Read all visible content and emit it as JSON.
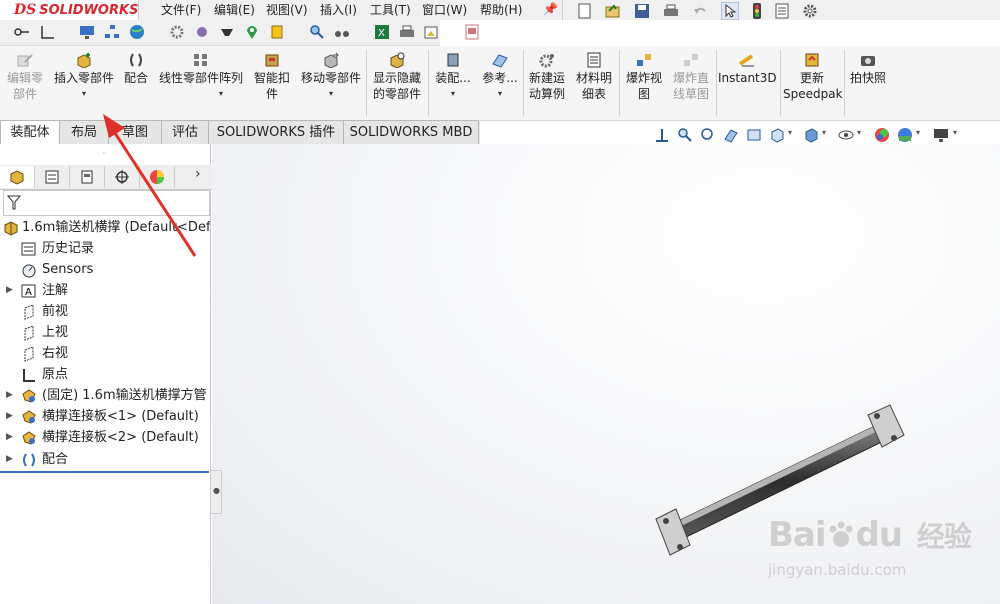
{
  "app": {
    "logo_ds": "DS",
    "logo_text": "SOLIDWORKS"
  },
  "menu": [
    "文件(F)",
    "编辑(E)",
    "视图(V)",
    "插入(I)",
    "工具(T)",
    "窗口(W)",
    "帮助(H)"
  ],
  "commands": [
    {
      "label": "编辑零\n部件",
      "disabled": true,
      "icon": "edit-component-icon"
    },
    {
      "label": "插入零部件",
      "disabled": false,
      "icon": "insert-component-icon"
    },
    {
      "label": "配合",
      "disabled": false,
      "icon": "mate-icon"
    },
    {
      "label": "线性零部件阵列",
      "disabled": false,
      "icon": "linear-pattern-icon"
    },
    {
      "label": "智能扣\n件",
      "disabled": false,
      "icon": "smart-fastener-icon"
    },
    {
      "label": "移动零部件",
      "disabled": false,
      "icon": "move-component-icon"
    },
    {
      "label": "显示隐藏\n的零部件",
      "disabled": false,
      "icon": "show-hidden-icon"
    },
    {
      "label": "装配...",
      "disabled": false,
      "icon": "assembly-features-icon"
    },
    {
      "label": "参考...",
      "disabled": false,
      "icon": "reference-geometry-icon"
    },
    {
      "label": "新建运\n动算例",
      "disabled": false,
      "icon": "motion-study-icon"
    },
    {
      "label": "材料明\n细表",
      "disabled": false,
      "icon": "bom-icon"
    },
    {
      "label": "爆炸视\n图",
      "disabled": false,
      "icon": "exploded-view-icon"
    },
    {
      "label": "爆炸直\n线草图",
      "disabled": true,
      "icon": "explode-line-sketch-icon"
    },
    {
      "label": "Instant3D",
      "disabled": false,
      "icon": "instant3d-icon"
    },
    {
      "label": "更新\nSpeedpak",
      "disabled": false,
      "icon": "speedpak-icon"
    },
    {
      "label": "拍快照",
      "disabled": false,
      "icon": "snapshot-icon"
    }
  ],
  "tabs": [
    "装配体",
    "布局",
    "草图",
    "评估",
    "SOLIDWORKS 插件",
    "SOLIDWORKS MBD"
  ],
  "tree": {
    "root": "1.6m输送机横撑  (Default<Def",
    "items": [
      {
        "label": "历史记录",
        "expand": false,
        "icon": "history-icon"
      },
      {
        "label": "Sensors",
        "expand": false,
        "icon": "sensors-icon"
      },
      {
        "label": "注解",
        "expand": true,
        "icon": "annotations-icon"
      },
      {
        "label": "前视",
        "expand": false,
        "icon": "plane-icon"
      },
      {
        "label": "上视",
        "expand": false,
        "icon": "plane-icon"
      },
      {
        "label": "右视",
        "expand": false,
        "icon": "plane-icon"
      },
      {
        "label": "原点",
        "expand": false,
        "icon": "origin-icon"
      },
      {
        "label": "(固定) 1.6m输送机横撑方管",
        "expand": true,
        "icon": "part-icon"
      },
      {
        "label": "横撑连接板<1> (Default)",
        "expand": true,
        "icon": "part-icon"
      },
      {
        "label": "横撑连接板<2> (Default)",
        "expand": true,
        "icon": "part-icon"
      },
      {
        "label": "配合",
        "expand": true,
        "icon": "mates-folder-icon"
      }
    ]
  },
  "watermark": {
    "brand": "Bai",
    "brand2": "du",
    "cn": "经验",
    "url": "jingyan.baidu.com"
  },
  "colors": {
    "accent": "#d9262f",
    "arrow": "#e0302b"
  }
}
